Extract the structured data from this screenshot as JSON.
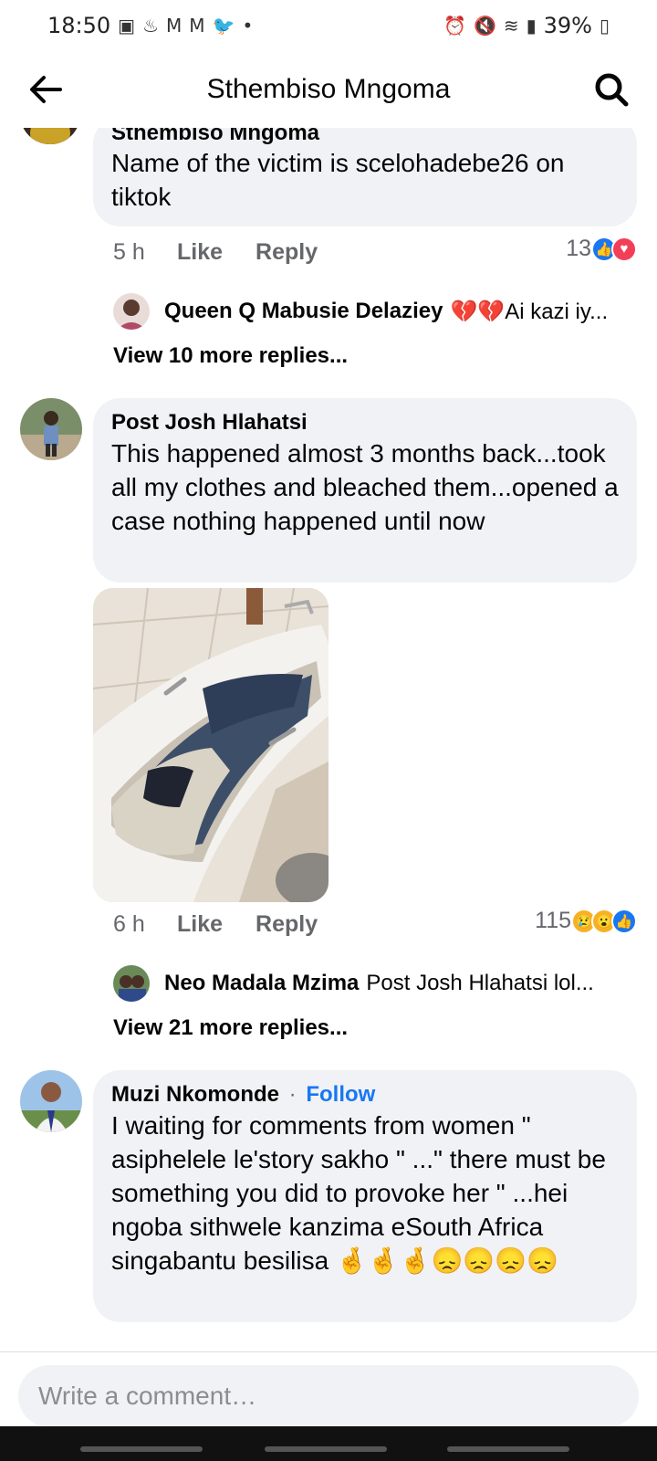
{
  "status_bar": {
    "time": "18:50",
    "left_icons": [
      "teams-icon",
      "notification-icon",
      "gmail-icon",
      "gmail-icon",
      "twitter-icon",
      "dot-icon"
    ],
    "right_icons": [
      "alarm-icon",
      "mute-icon",
      "wifi-icon",
      "signal-icon"
    ],
    "battery": "39%"
  },
  "header": {
    "title": "Sthembiso Mngoma"
  },
  "comments": [
    {
      "author": "Sthembiso Mngoma",
      "text": "Name of the victim is scelohadebe26 on tiktok",
      "time": "5 h",
      "like_label": "Like",
      "reply_label": "Reply",
      "reaction_count": "13",
      "reactions": [
        "like",
        "love"
      ],
      "reply_preview": {
        "name": "Queen Q Mabusie Delaziey",
        "text": "💔💔Ai kazi iy..."
      },
      "view_more": "View 10 more replies..."
    },
    {
      "author": "Post Josh Hlahatsi",
      "text": "This happened almost 3 months back...took all my clothes and bleached them...opened a case nothing happened until now",
      "time": "6 h",
      "like_label": "Like",
      "reply_label": "Reply",
      "reaction_count": "115",
      "reactions": [
        "sad",
        "wow",
        "like"
      ],
      "reply_preview": {
        "name": "Neo Madala Mzima",
        "text": "Post Josh Hlahatsi lol..."
      },
      "view_more": "View 21 more replies..."
    },
    {
      "author": "Muzi Nkomonde",
      "separator": "·",
      "follow_label": "Follow",
      "text": "I waiting for comments from women \" asiphelele le'story sakho \" ...\" there must be something you did to provoke her \" ...hei ngoba sithwele kanzima eSouth Africa singabantu besilisa 🤞🤞🤞😞😞😞😞"
    }
  ],
  "composer": {
    "placeholder": "Write a comment…"
  },
  "colors": {
    "accent": "#1877f2",
    "bubble": "#f0f2f5",
    "meta_text": "#65676b"
  }
}
